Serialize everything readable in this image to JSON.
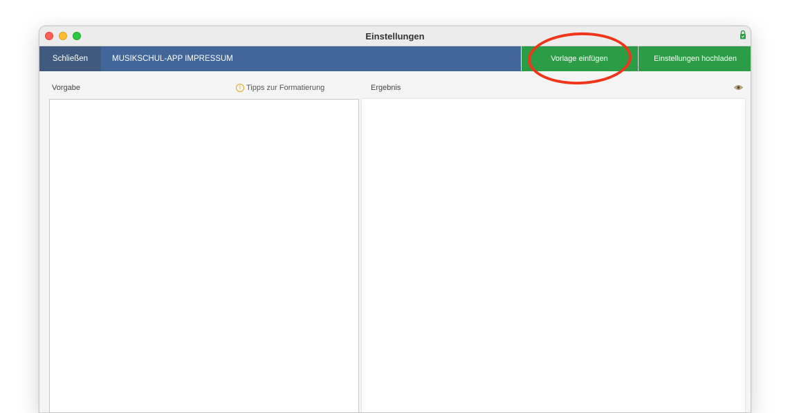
{
  "window": {
    "title": "Einstellungen"
  },
  "toolbar": {
    "close_label": "Schließen",
    "section_title": "MUSIKSCHUL-APP IMPRESSUM",
    "insert_template_label": "Vorlage einfügen",
    "upload_settings_label": "Einstellungen hochladen"
  },
  "editor": {
    "source_label": "Vorgabe",
    "tips_label": "Tipps zur Formatierung",
    "tips_icon": "info-icon",
    "result_label": "Ergebnis",
    "preview_icon": "eye-icon"
  },
  "colors": {
    "toolbar": "#42659a",
    "close_button": "#3f5a7e",
    "action_buttons": "#2c9c46",
    "annotation": "#f2341a"
  }
}
